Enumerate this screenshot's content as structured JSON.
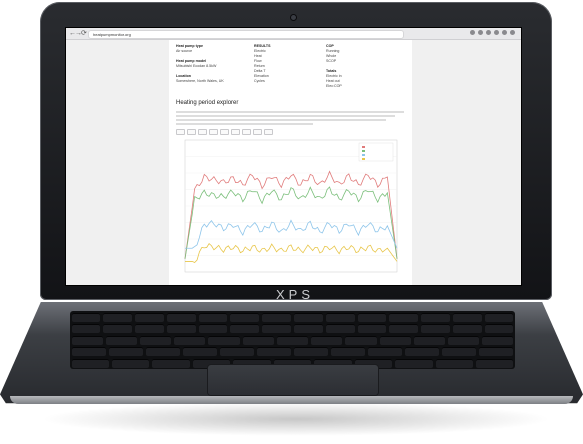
{
  "device": {
    "brand": "XPS"
  },
  "browser": {
    "url": "heatpumpmonitor.org",
    "back": "←",
    "forward": "→",
    "reload": "⟳"
  },
  "info": {
    "col1": {
      "heading": "Heat pump type",
      "value": "Air source",
      "heading2": "Heat pump model",
      "value2": "Mitsubishi Ecodan 8.5kW",
      "heading3": "Location",
      "value3": "Somewhere, North Wales, UK"
    },
    "col2": {
      "heading": "RESULTS",
      "rows": [
        {
          "label": "Electric",
          "value": ""
        },
        {
          "label": "Heat",
          "value": ""
        },
        {
          "label": "Flow",
          "value": ""
        },
        {
          "label": "Return",
          "value": ""
        },
        {
          "label": "Delta T",
          "value": ""
        },
        {
          "label": "Elevation",
          "value": ""
        },
        {
          "label": "Cycles",
          "value": ""
        }
      ]
    },
    "col3": {
      "heading": "COP",
      "rows": [
        {
          "label": "Running",
          "value": ""
        },
        {
          "label": "Whole",
          "value": ""
        },
        {
          "label": "SCOP",
          "value": ""
        }
      ],
      "heading2": "Totals",
      "rows2": [
        {
          "label": "Electric in",
          "value": ""
        },
        {
          "label": "Heat out",
          "value": ""
        },
        {
          "label": "Elec:COP",
          "value": ""
        }
      ]
    }
  },
  "section": {
    "title": "Heating period explorer",
    "paragraph": ""
  },
  "chart_toolbar": [
    "",
    "",
    "",
    "",
    "",
    "",
    "",
    "",
    ""
  ],
  "chart_data": {
    "type": "line",
    "title": "",
    "xlabel": "",
    "ylabel": "",
    "ylim": [
      0,
      100
    ],
    "series": [
      {
        "color": "#e07b7b",
        "values": [
          10,
          62,
          72,
          70,
          68,
          71,
          66,
          74,
          65,
          73,
          66,
          74,
          66,
          73,
          66,
          74,
          66,
          73,
          66,
          74,
          66,
          72,
          10
        ]
      },
      {
        "color": "#7bbf7b",
        "values": [
          10,
          55,
          60,
          58,
          57,
          61,
          55,
          63,
          54,
          62,
          55,
          63,
          55,
          62,
          55,
          63,
          55,
          62,
          55,
          63,
          55,
          60,
          10
        ]
      },
      {
        "color": "#8ec5ea",
        "values": [
          18,
          18,
          36,
          37,
          33,
          36,
          30,
          37,
          31,
          37,
          30,
          37,
          31,
          37,
          30,
          37,
          31,
          37,
          30,
          37,
          31,
          35,
          18
        ]
      },
      {
        "color": "#e8c64a",
        "values": [
          8,
          8,
          20,
          19,
          17,
          19,
          16,
          19,
          16,
          19,
          16,
          19,
          16,
          19,
          16,
          19,
          16,
          19,
          16,
          19,
          16,
          18,
          8
        ]
      }
    ],
    "legend": [
      "",
      "",
      "",
      ""
    ]
  }
}
